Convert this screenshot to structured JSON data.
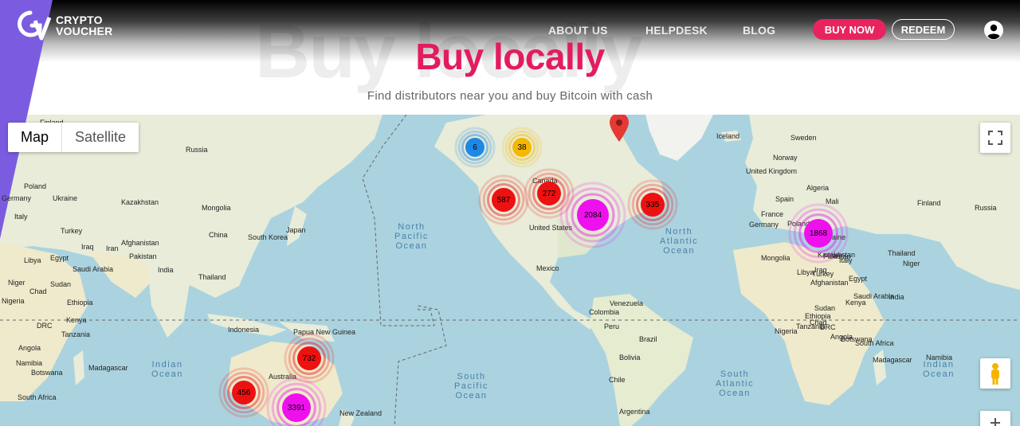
{
  "brand": {
    "logo_line1": "CRYPTO",
    "logo_line2": "VOUCHER",
    "accent_color": "#e31c5f",
    "purple_color": "#7b5ce0"
  },
  "nav": {
    "about_label": "ABOUT US",
    "helpdesk_label": "HELPDESK",
    "blog_label": "BLOG",
    "buy_label": "BUY NOW",
    "redeem_label": "REDEEM"
  },
  "hero": {
    "watermark": "Buy locally",
    "title": "Buy locally",
    "subtitle": "Find distributors near you and buy Bitcoin with cash"
  },
  "map": {
    "map_label": "Map",
    "satellite_label": "Satellite",
    "countries": [
      {
        "name": "Finland"
      },
      {
        "name": "Russia"
      },
      {
        "name": "Poland"
      },
      {
        "name": "Germany"
      },
      {
        "name": "Ukraine"
      },
      {
        "name": "Kazakhstan"
      },
      {
        "name": "Mongolia"
      },
      {
        "name": "Italy"
      },
      {
        "name": "Turkey"
      },
      {
        "name": "China"
      },
      {
        "name": "South Korea"
      },
      {
        "name": "Japan"
      },
      {
        "name": "Afghanistan"
      },
      {
        "name": "Iraq"
      },
      {
        "name": "Iran"
      },
      {
        "name": "Pakistan"
      },
      {
        "name": "Libya"
      },
      {
        "name": "Egypt"
      },
      {
        "name": "Saudi Arabia"
      },
      {
        "name": "India"
      },
      {
        "name": "Thailand"
      },
      {
        "name": "Niger"
      },
      {
        "name": "Sudan"
      },
      {
        "name": "Chad"
      },
      {
        "name": "Nigeria"
      },
      {
        "name": "Ethiopia"
      },
      {
        "name": "Kenya"
      },
      {
        "name": "DRC"
      },
      {
        "name": "Tanzania"
      },
      {
        "name": "Indonesia"
      },
      {
        "name": "Papua New Guinea"
      },
      {
        "name": "Angola"
      },
      {
        "name": "Namibia"
      },
      {
        "name": "Botswana"
      },
      {
        "name": "Madagascar"
      },
      {
        "name": "South Africa"
      },
      {
        "name": "Australia"
      },
      {
        "name": "New Zealand"
      },
      {
        "name": "Canada"
      },
      {
        "name": "United States"
      },
      {
        "name": "Mexico"
      },
      {
        "name": "Venezuela"
      },
      {
        "name": "Colombia"
      },
      {
        "name": "Peru"
      },
      {
        "name": "Brazil"
      },
      {
        "name": "Bolivia"
      },
      {
        "name": "Chile"
      },
      {
        "name": "Argentina"
      },
      {
        "name": "Iceland"
      },
      {
        "name": "Sweden"
      },
      {
        "name": "Norway"
      },
      {
        "name": "United Kingdom"
      },
      {
        "name": "Spain"
      },
      {
        "name": "Algeria"
      },
      {
        "name": "Mali"
      },
      {
        "name": "Finland"
      },
      {
        "name": "Russia"
      },
      {
        "name": "Poland"
      },
      {
        "name": "Germany"
      },
      {
        "name": "Ukraine"
      },
      {
        "name": "Kazakhstan"
      },
      {
        "name": "Mongolia"
      },
      {
        "name": "Italy"
      },
      {
        "name": "Turkey"
      },
      {
        "name": "Afghanistan"
      },
      {
        "name": "Iraq"
      },
      {
        "name": "Iran"
      },
      {
        "name": "Pakistan"
      },
      {
        "name": "Libya"
      },
      {
        "name": "Egypt"
      },
      {
        "name": "Saudi Arabia"
      },
      {
        "name": "India"
      },
      {
        "name": "Thailand"
      },
      {
        "name": "Niger"
      },
      {
        "name": "Sudan"
      },
      {
        "name": "Chad"
      },
      {
        "name": "Nigeria"
      },
      {
        "name": "Ethiopia"
      },
      {
        "name": "Kenya"
      },
      {
        "name": "DRC"
      },
      {
        "name": "Tanzania"
      },
      {
        "name": "Angola"
      },
      {
        "name": "Namibia"
      },
      {
        "name": "Botswana"
      },
      {
        "name": "Madagascar"
      },
      {
        "name": "South Africa"
      },
      {
        "name": "France"
      }
    ],
    "oceans": [
      {
        "name": "North Pacific Ocean"
      },
      {
        "name": "North Atlantic Ocean"
      },
      {
        "name": "Indian Ocean"
      },
      {
        "name": "South Pacific Ocean"
      },
      {
        "name": "South Atlantic Ocean"
      },
      {
        "name": "Indian Ocean"
      }
    ],
    "clusters": [
      {
        "count": "6",
        "color": "#1e88e5"
      },
      {
        "count": "38",
        "color": "#f5b800"
      },
      {
        "count": "587",
        "color": "#ee1111"
      },
      {
        "count": "272",
        "color": "#ee1111"
      },
      {
        "count": "2084",
        "color": "#ee11ee"
      },
      {
        "count": "335",
        "color": "#ee1111"
      },
      {
        "count": "1868",
        "color": "#ee11ee"
      },
      {
        "count": "732",
        "color": "#ee1111"
      },
      {
        "count": "456",
        "color": "#ee1111"
      },
      {
        "count": "3391",
        "color": "#ee11ee"
      }
    ]
  }
}
